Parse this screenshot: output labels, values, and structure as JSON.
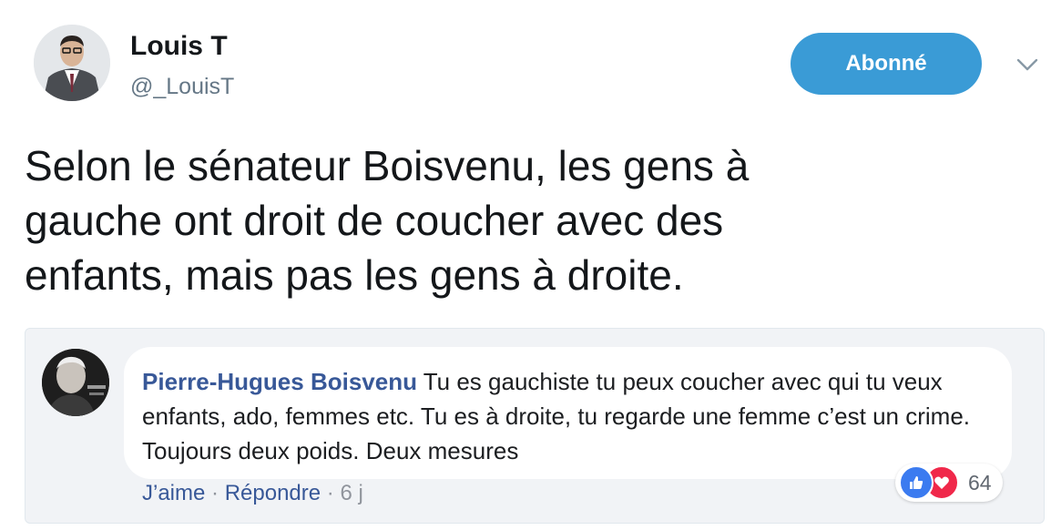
{
  "tweet": {
    "author_name": "Louis T",
    "author_handle": "@_LouisT",
    "follow_label": "Abonné",
    "text": "Selon le sénateur Boisvenu, les gens à\ngauche ont droit de coucher avec des\nenfants, mais pas les gens à droite."
  },
  "embedded_comment": {
    "author": "Pierre-Hugues Boisvenu",
    "text": " Tu es gauchiste tu peux coucher avec qui tu veux enfants, ado, femmes etc. Tu es à droite, tu regarde une femme c’est un crime. Toujours deux poids. Deux mesures",
    "like_label": "J’aime",
    "separator": " · ",
    "reply_label": "Répondre",
    "time": "6 j",
    "reaction_count": "64",
    "reaction_icons": [
      "like-icon",
      "love-icon"
    ]
  },
  "colors": {
    "follow_button": "#3a9bd6",
    "fb_link": "#385898",
    "like": "#3b7bf0",
    "love": "#f0284a"
  }
}
